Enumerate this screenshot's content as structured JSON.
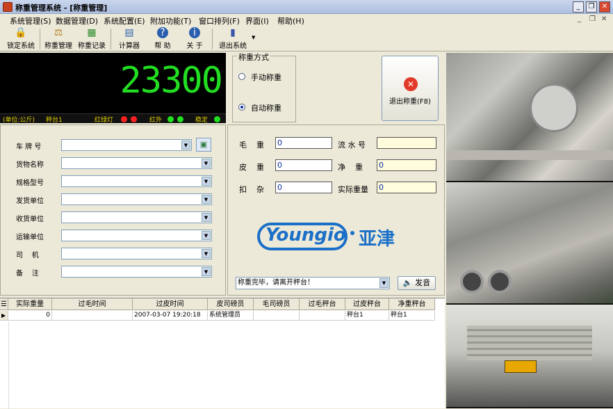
{
  "window": {
    "title": "称重管理系统 - [称重管理]"
  },
  "menu": [
    "系统管理(S)",
    "数据管理(D)",
    "系统配置(E)",
    "附加功能(T)",
    "窗口排列(F)",
    "界面(I)",
    "帮助(H)"
  ],
  "toolbar": [
    {
      "label": "锁定系统",
      "icon": "lock-icon"
    },
    {
      "label": "称重管理",
      "icon": "scale-icon"
    },
    {
      "label": "称重记录",
      "icon": "records-icon"
    },
    {
      "label": "计算器",
      "icon": "calculator-icon"
    },
    {
      "label": "帮 助",
      "icon": "help-icon"
    },
    {
      "label": "关 于",
      "icon": "info-icon"
    },
    {
      "label": "退出系统",
      "icon": "exit-door-icon"
    }
  ],
  "display": {
    "weight": "23300",
    "unit": "(单位:公斤)",
    "platform": "秤台1",
    "traffic_light": "红绿灯",
    "infrared": "红外",
    "stable": "稳定"
  },
  "mode": {
    "legend": "称重方式",
    "manual": "手动称重",
    "auto": "自动称重",
    "selected": "auto"
  },
  "exit_button": "退出称重(F8)",
  "form": {
    "plate": "车 牌 号",
    "goods": "货物名称",
    "spec": "规格型号",
    "sender": "发货单位",
    "receiver": "收货单位",
    "transport": "运输单位",
    "driver": "司    机",
    "note": "备    注"
  },
  "weights": {
    "gross_label": "毛    重",
    "gross": "0",
    "tare_label": "皮    重",
    "tare": "0",
    "deduct_label": "扣    杂",
    "deduct": "0",
    "serial_label": "流 水 号",
    "serial": "",
    "net_label": "净    重",
    "net": "0",
    "actual_label": "实际重量",
    "actual": "0"
  },
  "logo": {
    "brand": "Youngio",
    "cn": "亚津"
  },
  "message": "称重完毕，请离开秤台！",
  "speak_button": "发音",
  "table": {
    "headers": [
      "实际重量",
      "过毛时间",
      "过皮时间",
      "皮司磅员",
      "毛司磅员",
      "过毛秤台",
      "过皮秤台",
      "净重秤台"
    ],
    "rows": [
      [
        "0",
        "",
        "2007-03-07 19:20:18",
        "系统管理员",
        "",
        "",
        "秤台1",
        "秤台1"
      ]
    ]
  },
  "colors": {
    "digits": "#22dd22",
    "status": "#e6d200",
    "led_red": "#ff2020",
    "led_green": "#20e020"
  }
}
